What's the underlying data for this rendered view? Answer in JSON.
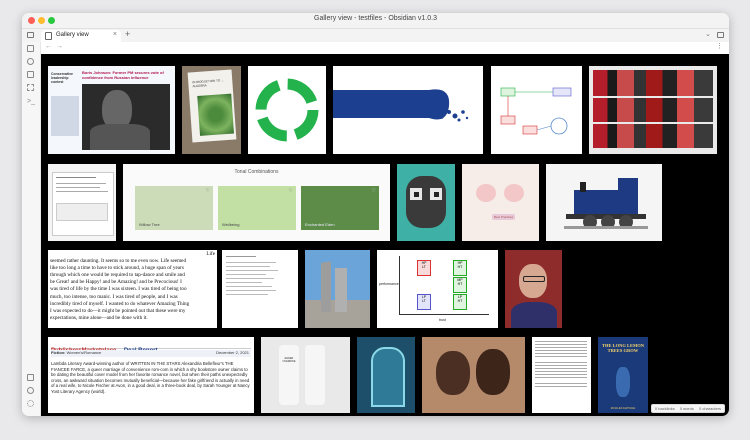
{
  "window": {
    "title": "Gallery view - testfiles - Obsidian v1.0.3"
  },
  "tab": {
    "label": "Gallery view"
  },
  "nav": {
    "back": "←",
    "forward": "→"
  },
  "tile_texts": {
    "book_hp": "Conservative leadership contest",
    "book_head": "Boris Johnson: Former PM secures vote of confidence from Russian influence",
    "green_book": "INTRODUCTION TO ... ALGEBRA",
    "tonal_title": "Tonal Combinations",
    "tonal_1": "Willow Tree",
    "tonal_2": "Wellbeing",
    "tonal_3": "Enchanted Eden",
    "pigs_label": "Best Practices",
    "quad_hp_lt": "HP\nLT",
    "quad_hp_ht": "HP\nHT",
    "quad_mp_ht": "MP\nHT",
    "quad_lp_ht": "LP\nHT",
    "quad_lp_lt": "LP\nLT",
    "quad_ylabel": "performance",
    "quad_xlabel": "trust",
    "poem_lines": [
      "Life",
      "seemed rather daunting. It seems so to me even now. Life seemed",
      "like too long a time to have to stick around, a huge span of years",
      "through which one would be required to tap-dance and smile and",
      "be Great! and be Happy! and be Amazing! and be Precocious! I",
      "was tired of life by the time I was sixteen. I was tired of being too",
      "much, too intense, too manic. I was tired of people, and I was",
      "incredibly tired of myself. I wanted to do whatever Amazing Thing",
      "I was expected to do—it might be pointed out that these were my",
      "expectations, mine alone—and be done with it."
    ],
    "pm_brand": "PublishersMarketplace",
    "pm_title": "Deal Report",
    "pm_fiction": "Fiction:",
    "pm_genre": "Women's/Romance",
    "pm_date": "December 2, 2021",
    "pm_body": "Lambda Literary Award-winning author of WRITTEN IN THE STARS Alexandria Bellefleur's THE FIANCEE FARCE, a queer marriage of convenience rom-com in which a shy bookstore owner claims to be dating the beautiful cover model from her favorite romance novel, but when their paths unexpectedly cross, an awkward situation becomes mutually beneficial—because her fake girlfriend is actually in need of a real wife, to Nicole Fischer at Avon, in a good deal, in a three-book deal, by Sarah Younger at Nancy Yost Literary Agency (world).",
    "bottle_text": "ENDER OVERRIDE",
    "lemon_title": "THE LONG LEMON TREES GROW",
    "lemon_author": "ZOULFA KATOUH"
  },
  "status": {
    "backlinks": "0 backlinks",
    "words": "0 words",
    "characters": "0 characters"
  },
  "colors": {
    "accent_green": "#23b24b",
    "blue": "#1c3f8f",
    "brick_blue": "#1e3a82",
    "titlebar": "#f3f3f4",
    "bg": "#000000"
  }
}
